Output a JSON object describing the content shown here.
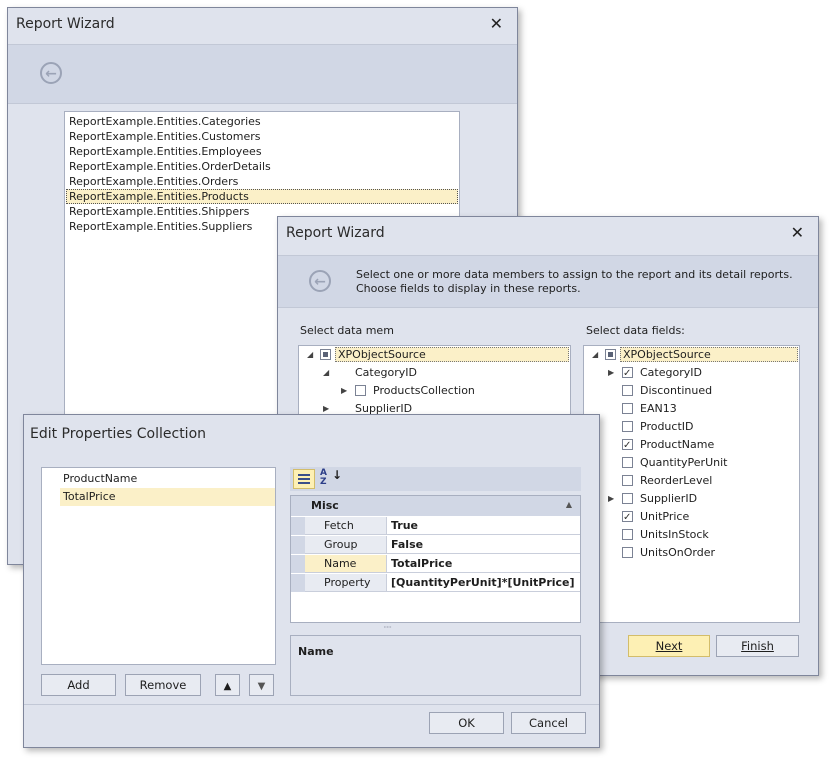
{
  "win1": {
    "title": "Report Wizard",
    "close": "✕",
    "back": "←",
    "items": [
      "ReportExample.Entities.Categories",
      "ReportExample.Entities.Customers",
      "ReportExample.Entities.Employees",
      "ReportExample.Entities.OrderDetails",
      "ReportExample.Entities.Orders",
      "ReportExample.Entities.Products",
      "ReportExample.Entities.Shippers",
      "ReportExample.Entities.Suppliers"
    ],
    "selected_index": 5
  },
  "win2": {
    "title": "Report Wizard",
    "close": "✕",
    "back": "←",
    "description_line1": "Select one or more data members to assign to the report and its detail reports.",
    "description_line2": "Choose fields to display in these reports.",
    "members_label": "Select data mem",
    "fields_label": "Select data fields:",
    "members": {
      "root": "XPObjectSource",
      "category": "CategoryID",
      "products_collection": "ProductsCollection",
      "supplier": "SupplierID"
    },
    "fields_root": "XPObjectSource",
    "fields": [
      {
        "label": "CategoryID",
        "checked": true,
        "expandable": true
      },
      {
        "label": "Discontinued",
        "checked": false,
        "expandable": false
      },
      {
        "label": "EAN13",
        "checked": false,
        "expandable": false
      },
      {
        "label": "ProductID",
        "checked": false,
        "expandable": false
      },
      {
        "label": "ProductName",
        "checked": true,
        "expandable": false
      },
      {
        "label": "QuantityPerUnit",
        "checked": false,
        "expandable": false
      },
      {
        "label": "ReorderLevel",
        "checked": false,
        "expandable": false
      },
      {
        "label": "SupplierID",
        "checked": false,
        "expandable": true
      },
      {
        "label": "UnitPrice",
        "checked": true,
        "expandable": false
      },
      {
        "label": "UnitsInStock",
        "checked": false,
        "expandable": false
      },
      {
        "label": "UnitsOnOrder",
        "checked": false,
        "expandable": false
      }
    ],
    "next": "Next",
    "finish": "Finish"
  },
  "win3": {
    "title": "Edit Properties Collection",
    "items": [
      "ProductName",
      "TotalPrice"
    ],
    "selected_index": 1,
    "add": "Add",
    "remove": "Remove",
    "up": "🡅",
    "down": "🡇",
    "category": "Misc",
    "props": [
      {
        "name": "Fetch",
        "value": "True"
      },
      {
        "name": "Group",
        "value": "False"
      },
      {
        "name": "Name",
        "value": "TotalPrice"
      },
      {
        "name": "Property",
        "value": "[QuantityPerUnit]*[UnitPrice]"
      }
    ],
    "selected_prop": 2,
    "description_title": "Name",
    "ok": "OK",
    "cancel": "Cancel",
    "splitter": "·····"
  }
}
